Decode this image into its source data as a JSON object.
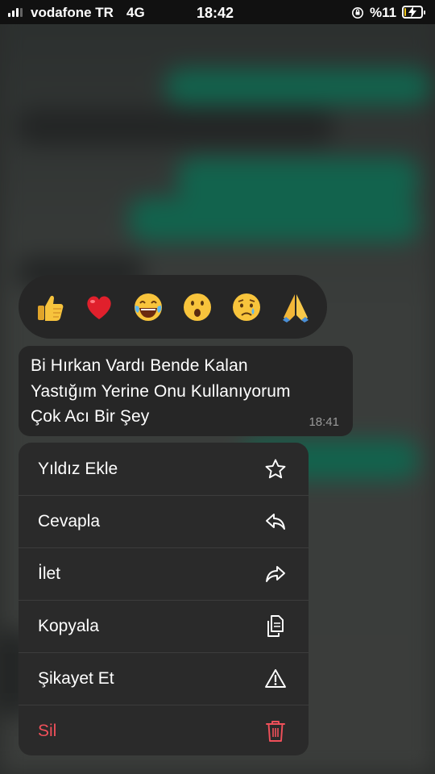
{
  "status_bar": {
    "carrier": "vodafone TR",
    "network": "4G",
    "time": "18:42",
    "battery": "%11",
    "battery_level_percent": 11,
    "icons": [
      "signal-icon",
      "orientation-lock-icon",
      "battery-charging-icon"
    ]
  },
  "reactions": [
    {
      "name": "thumbs-up",
      "emoji": "👍"
    },
    {
      "name": "heart",
      "emoji": "❤️"
    },
    {
      "name": "laughing",
      "emoji": "😂"
    },
    {
      "name": "surprised",
      "emoji": "😮"
    },
    {
      "name": "crying",
      "emoji": "😢"
    },
    {
      "name": "pray",
      "emoji": "🙏"
    }
  ],
  "message": {
    "lines": [
      "Bi Hırkan Vardı Bende Kalan",
      "Yastığım Yerine Onu Kullanıyorum",
      "Çok Acı Bir Şey"
    ],
    "time": "18:41"
  },
  "menu": {
    "items": [
      {
        "label": "Yıldız Ekle",
        "icon": "star-icon"
      },
      {
        "label": "Cevapla",
        "icon": "reply-icon"
      },
      {
        "label": "İlet",
        "icon": "forward-icon"
      },
      {
        "label": "Kopyala",
        "icon": "copy-icon"
      },
      {
        "label": "Şikayet Et",
        "icon": "warning-icon"
      },
      {
        "label": "Sil",
        "icon": "trash-icon",
        "danger": true
      }
    ]
  },
  "colors": {
    "danger": "#f0505a",
    "bubble": "#262626",
    "menu": "#2a2a2a",
    "battery_fill": "#f2c81b"
  }
}
